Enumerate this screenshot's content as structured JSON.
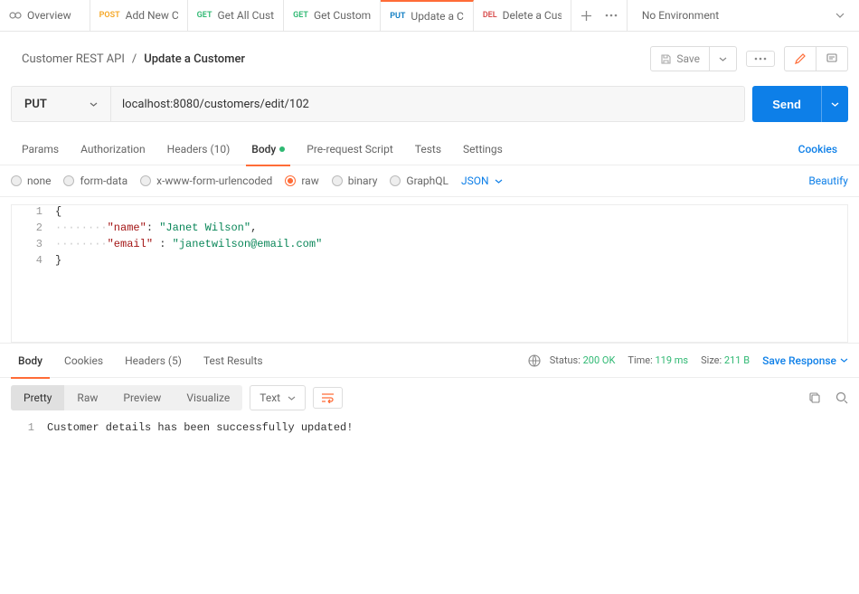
{
  "tabs": {
    "overview": "Overview",
    "items": [
      {
        "method": "POST",
        "label": "Add New C"
      },
      {
        "method": "GET",
        "label": "Get All Cust"
      },
      {
        "method": "GET",
        "label": "Get Custom"
      },
      {
        "method": "PUT",
        "label": "Update a C"
      },
      {
        "method": "DEL",
        "label": "Delete a Cus"
      }
    ],
    "env": "No Environment"
  },
  "breadcrumb": {
    "parent": "Customer REST API",
    "sep": "/",
    "current": "Update a Customer",
    "save": "Save"
  },
  "request": {
    "method": "PUT",
    "url": "localhost:8080/customers/edit/102",
    "send": "Send"
  },
  "req_tabs": {
    "params": "Params",
    "auth": "Authorization",
    "headers": "Headers (10)",
    "body": "Body",
    "prereq": "Pre-request Script",
    "tests": "Tests",
    "settings": "Settings",
    "cookies": "Cookies"
  },
  "body_types": {
    "none": "none",
    "form": "form-data",
    "urlenc": "x-www-form-urlencoded",
    "raw": "raw",
    "binary": "binary",
    "graphql": "GraphQL",
    "json": "JSON",
    "beautify": "Beautify"
  },
  "editor": {
    "lines": [
      "1",
      "2",
      "3",
      "4"
    ],
    "l1": "{",
    "l2_key": "\"name\"",
    "l2_val": "\"Janet Wilson\"",
    "l3_key": "\"email\"",
    "l3_val": "\"janetwilson@email.com\"",
    "l4": "}"
  },
  "response": {
    "tabs": {
      "body": "Body",
      "cookies": "Cookies",
      "headers": "Headers (5)",
      "tests": "Test Results"
    },
    "status_label": "Status:",
    "status_value": "200 OK",
    "time_label": "Time:",
    "time_value": "119 ms",
    "size_label": "Size:",
    "size_value": "211 B",
    "save": "Save Response",
    "views": {
      "pretty": "Pretty",
      "raw": "Raw",
      "preview": "Preview",
      "visualize": "Visualize"
    },
    "format": "Text",
    "body_line_num": "1",
    "body_text": "Customer details has been successfully updated!"
  }
}
